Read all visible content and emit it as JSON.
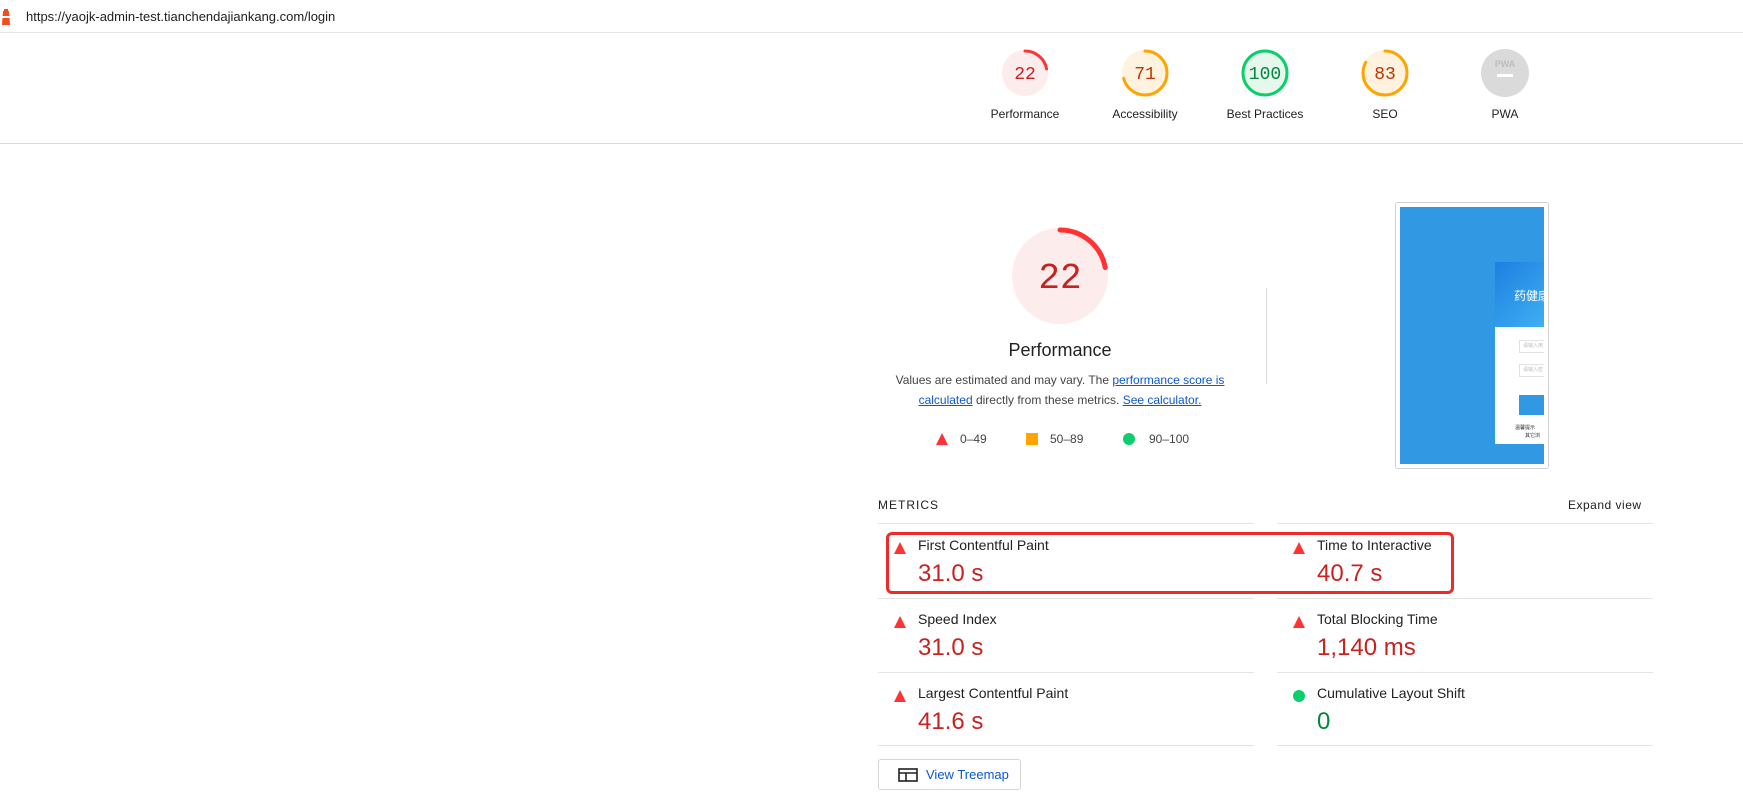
{
  "url": "https://yaojk-admin-test.tianchendajiankang.com/login",
  "colors": {
    "fail": "#ff3333",
    "average": "#ffa400",
    "pass": "#0cce6b",
    "fail_text": "#c7221f",
    "average_text": "#c33300",
    "pass_text": "#018642",
    "na": "#cccccc"
  },
  "scores": [
    {
      "name": "Performance",
      "value": "22",
      "score": 22,
      "rating": "fail"
    },
    {
      "name": "Accessibility",
      "value": "71",
      "score": 71,
      "rating": "average"
    },
    {
      "name": "Best Practices",
      "value": "100",
      "score": 100,
      "rating": "pass"
    },
    {
      "name": "SEO",
      "value": "83",
      "score": 83,
      "rating": "average"
    },
    {
      "name": "PWA",
      "value": "",
      "score": 0,
      "rating": "na",
      "icon": "pwa-icon"
    }
  ],
  "performance": {
    "score": "22",
    "title": "Performance",
    "desc_prefix": "Values are estimated and may vary. The",
    "desc_link": "performance score is calculated",
    "desc_mid": "directly from these metrics.",
    "desc_link2": "See calculator."
  },
  "legend": [
    {
      "shape": "triangle",
      "label": "0–49"
    },
    {
      "shape": "square",
      "label": "50–89"
    },
    {
      "shape": "circle",
      "label": "90–100"
    }
  ],
  "thumbnail": {
    "card_text": "药健康",
    "field1": "请输入用",
    "field2": "请输入密",
    "foot1": "温馨提示",
    "foot2": "其它浏"
  },
  "metrics": {
    "title": "METRICS",
    "expand": "Expand view",
    "items": [
      {
        "label": "First Contentful Paint",
        "value": "31.0 s",
        "rating": "fail"
      },
      {
        "label": "Time to Interactive",
        "value": "40.7 s",
        "rating": "fail"
      },
      {
        "label": "Speed Index",
        "value": "31.0 s",
        "rating": "fail"
      },
      {
        "label": "Total Blocking Time",
        "value": "1,140 ms",
        "rating": "fail"
      },
      {
        "label": "Largest Contentful Paint",
        "value": "41.6 s",
        "rating": "fail"
      },
      {
        "label": "Cumulative Layout Shift",
        "value": "0",
        "rating": "pass"
      }
    ]
  },
  "treemap": {
    "label": "View Treemap",
    "icon": "treemap-icon"
  }
}
